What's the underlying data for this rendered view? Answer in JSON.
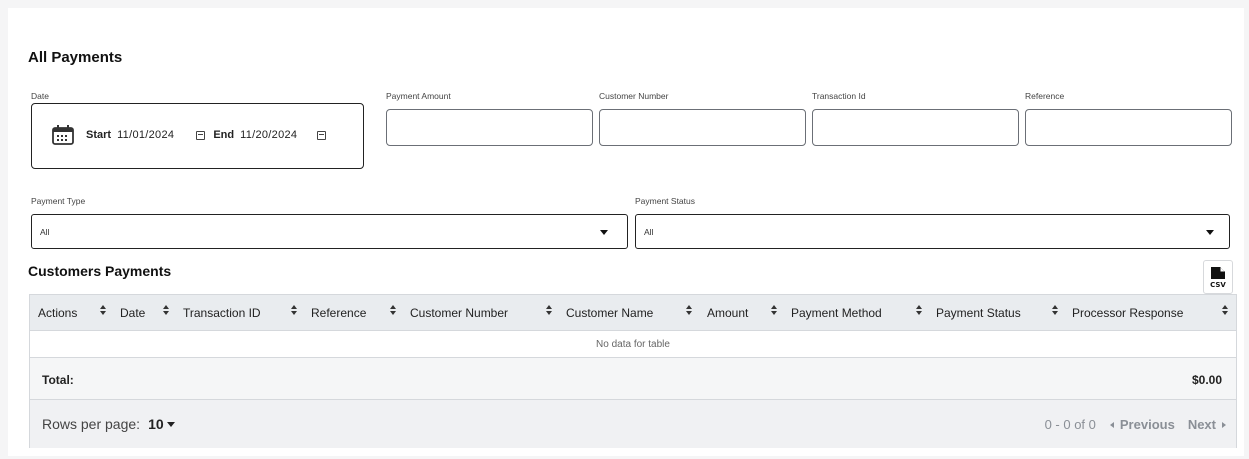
{
  "page": {
    "title": "All Payments"
  },
  "filters": {
    "date": {
      "label": "Date",
      "start_label": "Start",
      "start_value": "11/01/2024",
      "end_label": "End",
      "end_value": "11/20/2024"
    },
    "payment_amount": {
      "label": "Payment Amount",
      "value": ""
    },
    "customer_number": {
      "label": "Customer Number",
      "value": ""
    },
    "transaction_id": {
      "label": "Transaction Id",
      "value": ""
    },
    "reference": {
      "label": "Reference",
      "value": ""
    },
    "payment_type": {
      "label": "Payment Type",
      "selected": "All"
    },
    "payment_status": {
      "label": "Payment Status",
      "selected": "All"
    }
  },
  "table": {
    "title": "Customers Payments",
    "export_icon": "csv-file-icon",
    "columns": [
      "Actions",
      "Date",
      "Transaction ID",
      "Reference",
      "Customer Number",
      "Customer Name",
      "Amount",
      "Payment Method",
      "Payment Status",
      "Processor Response"
    ],
    "empty_text": "No data for table",
    "total_label": "Total:",
    "total_value": "$0.00"
  },
  "pagination": {
    "rows_label": "Rows per page:",
    "rows_value": "10",
    "range": "0 - 0 of 0",
    "prev": "Previous",
    "next": "Next"
  },
  "colors": {
    "header_bg": "#e9ecef",
    "border": "#d5d8dc",
    "muted": "#8a8f96"
  }
}
